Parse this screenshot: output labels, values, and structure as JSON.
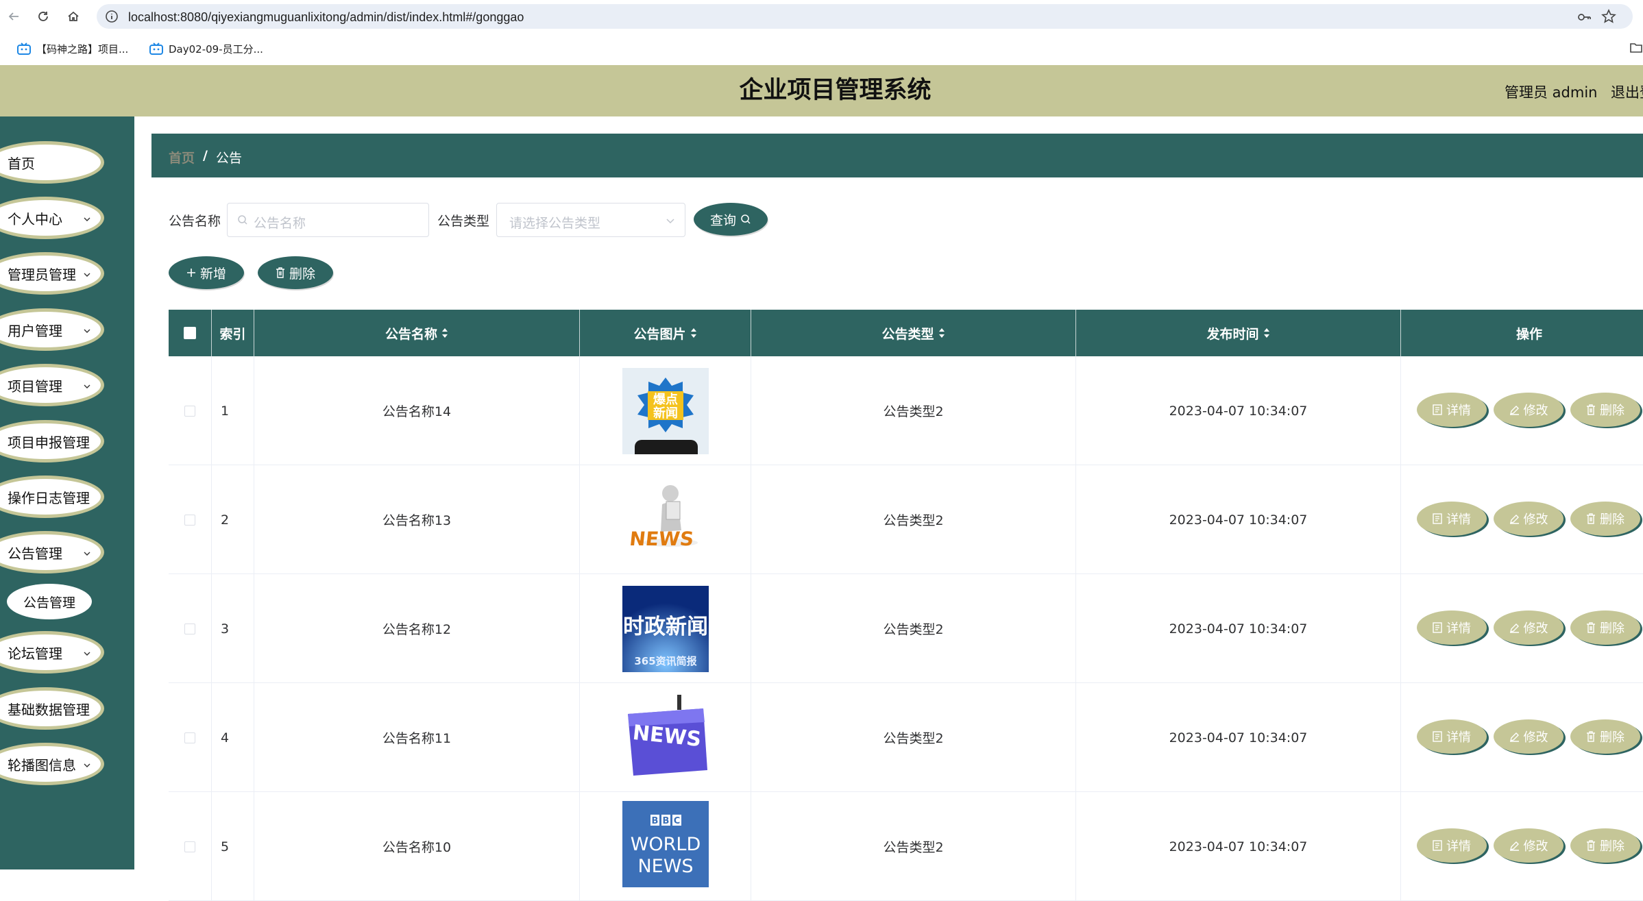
{
  "browser": {
    "url": "localhost:8080/qiyexiangmuguanlixitong/admin/dist/index.html#/gonggao",
    "bookmarks": [
      {
        "label": "【码神之路】项目..."
      },
      {
        "label": "Day02-09-员工分..."
      }
    ]
  },
  "header": {
    "title": "企业项目管理系统",
    "user": "管理员 admin",
    "logout": "退出登录"
  },
  "sidebar": {
    "items": [
      {
        "label": "首页"
      },
      {
        "label": "个人中心"
      },
      {
        "label": "管理员管理"
      },
      {
        "label": "用户管理"
      },
      {
        "label": "项目管理"
      },
      {
        "label": "项目申报管理"
      },
      {
        "label": "操作日志管理"
      },
      {
        "label": "公告管理"
      },
      {
        "label": "论坛管理"
      },
      {
        "label": "基础数据管理"
      },
      {
        "label": "轮播图信息"
      }
    ],
    "active_sub": "公告管理"
  },
  "breadcrumb": {
    "home": "首页",
    "separator": "/",
    "current": "公告"
  },
  "search": {
    "name_label": "公告名称",
    "name_placeholder": "公告名称",
    "type_label": "公告类型",
    "type_placeholder": "请选择公告类型",
    "query_button": "查询"
  },
  "actions": {
    "add": "新增",
    "delete": "删除"
  },
  "table": {
    "columns": [
      "索引",
      "公告名称",
      "公告图片",
      "公告类型",
      "发布时间",
      "操作"
    ],
    "row_actions": {
      "detail": "详情",
      "edit": "修改",
      "delete": "删除"
    },
    "rows": [
      {
        "index": "1",
        "name": "公告名称14",
        "type": "公告类型2",
        "time": "2023-04-07 10:34:07",
        "image": "爆点新闻"
      },
      {
        "index": "2",
        "name": "公告名称13",
        "type": "公告类型2",
        "time": "2023-04-07 10:34:07",
        "image": "NEWS"
      },
      {
        "index": "3",
        "name": "公告名称12",
        "type": "公告类型2",
        "time": "2023-04-07 10:34:07",
        "image": "时政新闻"
      },
      {
        "index": "4",
        "name": "公告名称11",
        "type": "公告类型2",
        "time": "2023-04-07 10:34:07",
        "image": "NEWS"
      },
      {
        "index": "5",
        "name": "公告名称10",
        "type": "公告类型2",
        "time": "2023-04-07 10:34:07",
        "image": "BBC WORLD NEWS"
      }
    ]
  },
  "colors": {
    "primary": "#2e6461",
    "accent": "#c5c697"
  }
}
